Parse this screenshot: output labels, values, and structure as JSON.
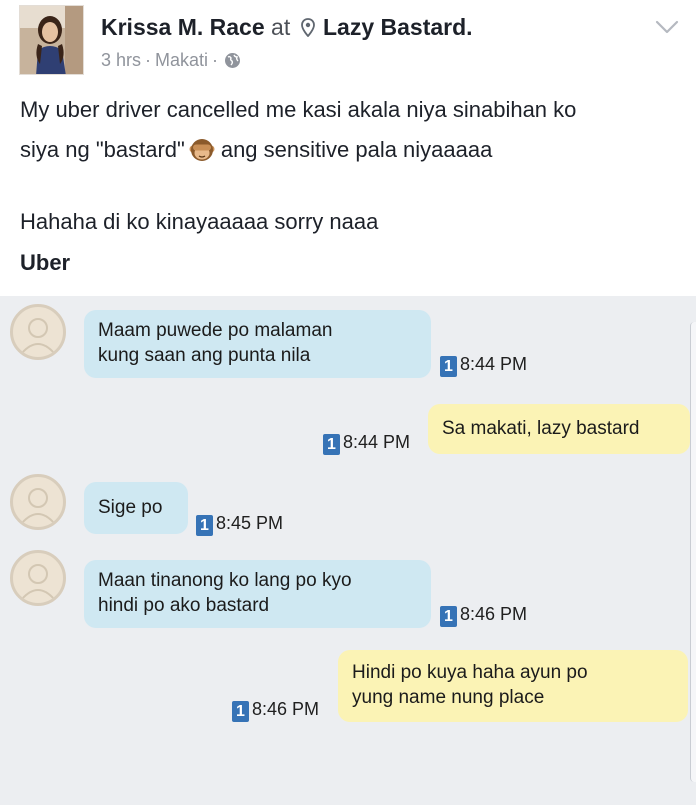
{
  "post": {
    "author": "Krissa M. Race",
    "at_word": "at",
    "place": "Lazy Bastard.",
    "time": "3 hrs",
    "separator": "·",
    "location": "Makati",
    "privacy_icon": "globe-icon",
    "location_icon": "map-pin-icon",
    "menu_icon": "chevron-down-icon",
    "text_line1": "My uber driver cancelled me kasi akala niya sinabihan ko",
    "text_line2_a": "siya ng \"bastard\"",
    "text_line2_emoji": "see-no-evil-monkey-icon",
    "text_line2_b": "ang sensitive pala niyaaaaa",
    "text_line3": "Hahaha di ko kinayaaaaa sorry naaa",
    "label": "Uber"
  },
  "chat": {
    "unread_badge": "1",
    "messages": [
      {
        "direction": "incoming",
        "line1": "Maam puwede po malaman",
        "line2": "kung saan ang punta nila",
        "time": "8:44 PM"
      },
      {
        "direction": "outgoing",
        "line1": "Sa makati, lazy bastard",
        "time": "8:44 PM"
      },
      {
        "direction": "incoming",
        "line1": "Sige po",
        "time": "8:45 PM"
      },
      {
        "direction": "incoming",
        "line1": "Maan tinanong ko lang po kyo",
        "line2": "hindi po ako bastard",
        "time": "8:46 PM"
      },
      {
        "direction": "outgoing",
        "line1": "Hindi po kuya haha ayun po",
        "line2": "yung name nung place",
        "time": "8:46 PM"
      }
    ]
  },
  "colors": {
    "incoming_bubble": "#cfe8f2",
    "outgoing_bubble": "#fbf3b5",
    "unread_badge": "#3673b6",
    "chat_background": "#eceef1"
  }
}
